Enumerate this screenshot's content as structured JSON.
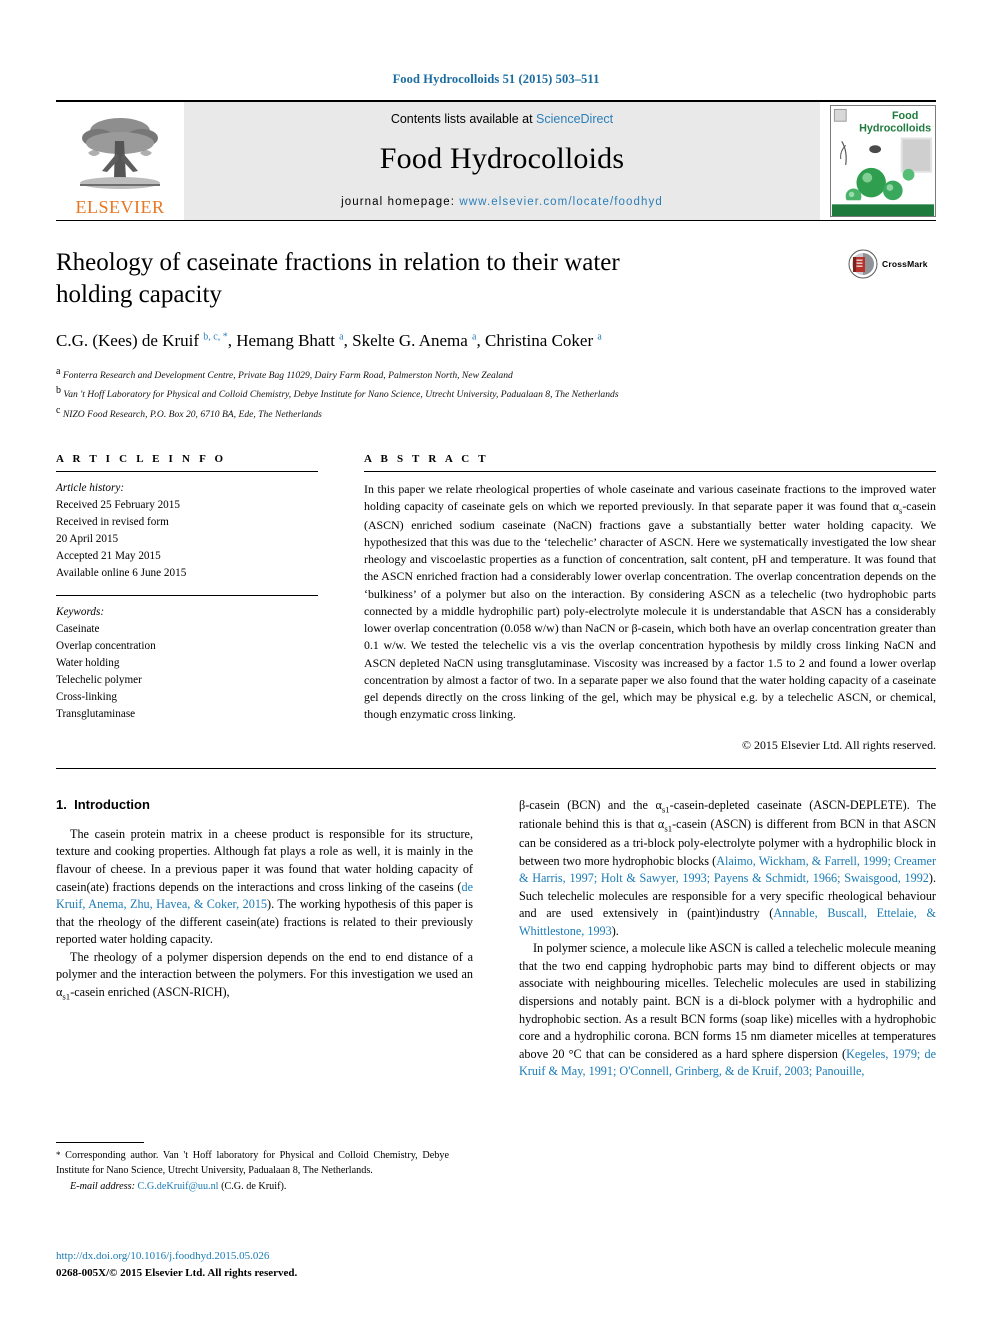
{
  "running_head": "Food Hydrocolloids 51 (2015) 503–511",
  "masthead": {
    "contents_prefix": "Contents lists available at ",
    "sciencedirect": "ScienceDirect",
    "journal_title": "Food Hydrocolloids",
    "homepage_prefix": "journal homepage: ",
    "homepage_url": "www.elsevier.com/locate/foodhyd",
    "publisher": "ELSEVIER",
    "cover_line1": "Food",
    "cover_line2": "Hydrocolloids",
    "accent_blue": "#2c7fb8",
    "elsevier_orange": "#E87722",
    "cover_green": "#1f7a3d"
  },
  "article": {
    "title": "Rheology of caseinate fractions in relation to their water holding capacity",
    "authors": [
      {
        "name": "C.G. (Kees) de Kruif",
        "marks": "b, c, *"
      },
      {
        "name": "Hemang Bhatt",
        "marks": "a"
      },
      {
        "name": "Skelte G. Anema",
        "marks": "a"
      },
      {
        "name": "Christina Coker",
        "marks": "a"
      }
    ],
    "affiliations": [
      {
        "mark": "a",
        "text": "Fonterra Research and Development Centre, Private Bag 11029, Dairy Farm Road, Palmerston North, New Zealand"
      },
      {
        "mark": "b",
        "text": "Van 't Hoff Laboratory for Physical and Colloid Chemistry, Debye Institute for Nano Science, Utrecht University, Padualaan 8, The Netherlands"
      },
      {
        "mark": "c",
        "text": "NIZO Food Research, P.O. Box 20, 6710 BA, Ede, The Netherlands"
      }
    ],
    "crossmark_label": "CrossMark"
  },
  "article_info": {
    "heading": "A R T I C L E  I N F O",
    "history_label": "Article history:",
    "history": [
      "Received 25 February 2015",
      "Received in revised form",
      "20 April 2015",
      "Accepted 21 May 2015",
      "Available online 6 June 2015"
    ],
    "keywords_label": "Keywords:",
    "keywords": [
      "Caseinate",
      "Overlap concentration",
      "Water holding",
      "Telechelic polymer",
      "Cross-linking",
      "Transglutaminase"
    ]
  },
  "abstract": {
    "heading": "A B S T R A C T",
    "text_part1": "In this paper we relate rheological properties of whole caseinate and various caseinate fractions to the improved water holding capacity of caseinate gels on which we reported previously. In that separate paper it was found that α",
    "sub1": "s",
    "text_part2": "-casein (ASCN) enriched sodium caseinate (NaCN) fractions gave a substantially better water holding capacity. We hypothesized that this was due to the ‘telechelic’ character of ASCN. Here we systematically investigated the low shear rheology and viscoelastic properties as a function of concentration, salt content, pH and temperature. It was found that the ASCN enriched fraction had a considerably lower overlap concentration. The overlap concentration depends on the ‘bulkiness’ of a polymer but also on the interaction. By considering ASCN as a telechelic (two hydrophobic parts connected by a middle hydrophilic part) poly-electrolyte molecule it is understandable that ASCN has a considerably lower overlap concentration (0.058 w/w) than NaCN or β-casein, which both have an overlap concentration greater than 0.1 w/w. We tested the telechelic vis a vis the overlap concentration hypothesis by mildly cross linking NaCN and ASCN depleted NaCN using transglutaminase. Viscosity was increased by a factor 1.5 to 2 and found a lower overlap concentration by almost a factor of two. In a separate paper we also found that the water holding capacity of a caseinate gel depends directly on the cross linking of the gel, which may be physical e.g. by a telechelic ASCN, or chemical, though enzymatic cross linking.",
    "copyright": "© 2015 Elsevier Ltd. All rights reserved."
  },
  "introduction": {
    "section_number": "1.",
    "section_title": "Introduction",
    "left": {
      "p1_a": "The casein protein matrix in a cheese product is responsible for its structure, texture and cooking properties. Although fat plays a role as well, it is mainly in the flavour of cheese. In a previous paper it was found that water holding capacity of casein(ate) fractions depends on the interactions and cross linking of the caseins (",
      "p1_ref": "de Kruif, Anema, Zhu, Havea, & Coker, 2015",
      "p1_b": "). The working hypothesis of this paper is that the rheology of the different casein(ate) fractions is related to their previously reported water holding capacity.",
      "p2_a": "The rheology of a polymer dispersion depends on the end to end distance of a polymer and the interaction between the polymers. For this investigation we used an α",
      "p2_sub": "s1",
      "p2_b": "-casein enriched (ASCN-RICH),"
    },
    "right": {
      "p1_a": "β-casein (BCN) and the α",
      "p1_sub1": "s1",
      "p1_b": "-casein-depleted caseinate (ASCN-DEPLETE). The rationale behind this is that α",
      "p1_sub2": "s1",
      "p1_c": "-casein (ASCN) is different from BCN in that ASCN can be considered as a tri-block poly-electrolyte polymer with a hydrophilic block in between two more hydrophobic blocks (",
      "p1_ref": "Alaimo, Wickham, & Farrell, 1999; Creamer & Harris, 1997; Holt & Sawyer, 1993; Payens & Schmidt, 1966; Swaisgood, 1992",
      "p1_d": "). Such telechelic molecules are responsible for a very specific rheological behaviour and are used extensively in (paint)industry (",
      "p1_ref2": "Annable, Buscall, Ettelaie, & Whittlestone, 1993",
      "p1_e": ").",
      "p2_a": "In polymer science, a molecule like ASCN is called a telechelic molecule meaning that the two end capping hydrophobic parts may bind to different objects or may associate with neighbouring micelles. Telechelic molecules are used in stabilizing dispersions and notably paint. BCN is a di-block polymer with a hydrophilic and hydrophobic section. As a result BCN forms (soap like) micelles with a hydrophobic core and a hydrophilic corona. BCN forms 15 nm diameter micelles at temperatures above 20 °C that can be considered as a hard sphere dispersion (",
      "p2_ref": "Kegeles, 1979; de Kruif & May, 1991; O'Connell, Grinberg, & de Kruif, 2003; Panouille,"
    }
  },
  "footer": {
    "corr_star": "*",
    "corr_text": " Corresponding author. Van 't Hoff laboratory for Physical and Colloid Chemistry, Debye Institute for Nano Science, Utrecht University, Padualaan 8, The Netherlands.",
    "email_label": "E-mail address:",
    "email": "C.G.deKruif@uu.nl",
    "email_owner": " (C.G. de Kruif).",
    "doi": "http://dx.doi.org/10.1016/j.foodhyd.2015.05.026",
    "issn": "0268-005X/© 2015 Elsevier Ltd. All rights reserved."
  }
}
